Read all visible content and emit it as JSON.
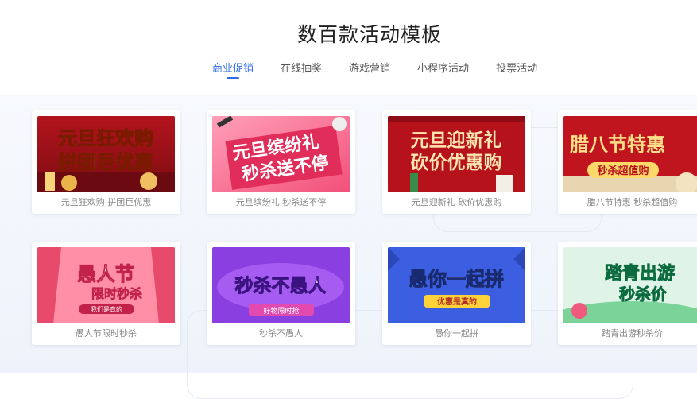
{
  "header": {
    "title": "数百款活动模板"
  },
  "tabs": [
    {
      "label": "商业促销",
      "active": true
    },
    {
      "label": "在线抽奖",
      "active": false
    },
    {
      "label": "游戏营销",
      "active": false
    },
    {
      "label": "小程序活动",
      "active": false
    },
    {
      "label": "投票活动",
      "active": false
    }
  ],
  "accent_color": "#2f6de8",
  "templates": [
    {
      "caption": "元旦狂欢购 拼团巨优惠",
      "line1": "元旦狂欢购",
      "line2": "拼团巨优惠"
    },
    {
      "caption": "元旦缤纷礼 秒杀送不停",
      "line1": "元旦缤纷礼",
      "line2": "秒杀送不停"
    },
    {
      "caption": "元旦迎新礼 砍价优惠购",
      "line1": "元旦迎新礼",
      "line2": "砍价优惠购"
    },
    {
      "caption": "腊八节特惠 秒杀超值购",
      "line1": "腊八节特惠",
      "line2": "秒杀超值购"
    },
    {
      "caption": "愚人节限时秒杀",
      "line1": "愚人节",
      "line2": "限时秒杀",
      "line3": "我们是真的"
    },
    {
      "caption": "秒杀不愚人",
      "line1": "秒杀不愚人",
      "line2": "好物限时抢"
    },
    {
      "caption": "愚你一起拼",
      "line1": "愚你一起拼",
      "line2": "优惠是真的"
    },
    {
      "caption": "踏青出游秒杀价",
      "line1": "踏青出游",
      "line2": "秒杀价"
    }
  ]
}
